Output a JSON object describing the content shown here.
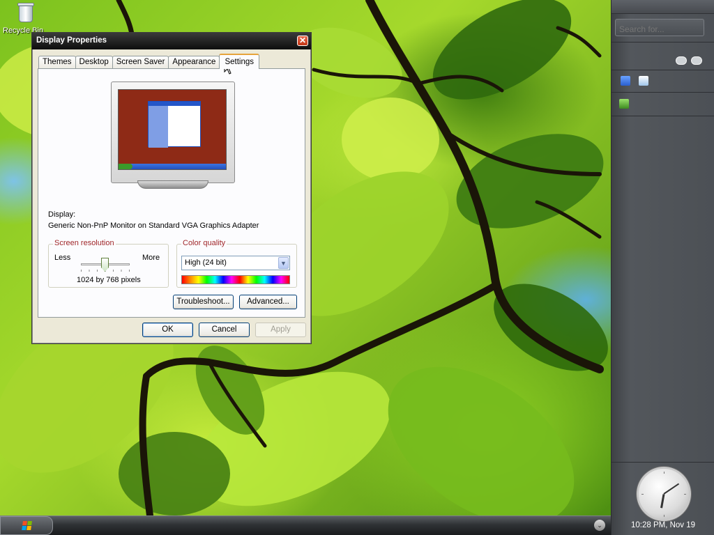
{
  "desktop": {
    "recycle_bin_label": "Recycle Bin"
  },
  "dialog": {
    "title": "Display Properties",
    "close_symbol": "✕",
    "tabs": [
      {
        "label": "Themes"
      },
      {
        "label": "Desktop"
      },
      {
        "label": "Screen Saver"
      },
      {
        "label": "Appearance"
      },
      {
        "label": "Settings",
        "active": true
      }
    ],
    "display_label": "Display:",
    "display_value": "Generic Non-PnP Monitor on Standard VGA Graphics Adapter",
    "screen_resolution": {
      "legend": "Screen resolution",
      "less_label": "Less",
      "more_label": "More",
      "value_text": "1024 by 768 pixels"
    },
    "color_quality": {
      "legend": "Color quality",
      "selected": "High (24 bit)"
    },
    "buttons": {
      "troubleshoot": "Troubleshoot...",
      "advanced": "Advanced...",
      "ok": "OK",
      "cancel": "Cancel",
      "apply": "Apply"
    }
  },
  "sidebar": {
    "search_placeholder": "Search for...",
    "clock_datetime": "10:28 PM, Nov 19"
  },
  "colors": {
    "title_bar": "#1a1a1a",
    "dialog_bg": "#ece9d8",
    "active_tab_accent": "#e6a33b",
    "legend_text": "#a0272a",
    "sidebar_bg": "#4c5055"
  },
  "icons": [
    "recycle-bin-icon",
    "close-icon",
    "monitor-preview-icon",
    "dropdown-arrow-icon",
    "chat-icon",
    "gadget-icon",
    "clock-icon",
    "windows-flag-icon",
    "chevron-down-icon",
    "mouse-cursor-icon"
  ]
}
